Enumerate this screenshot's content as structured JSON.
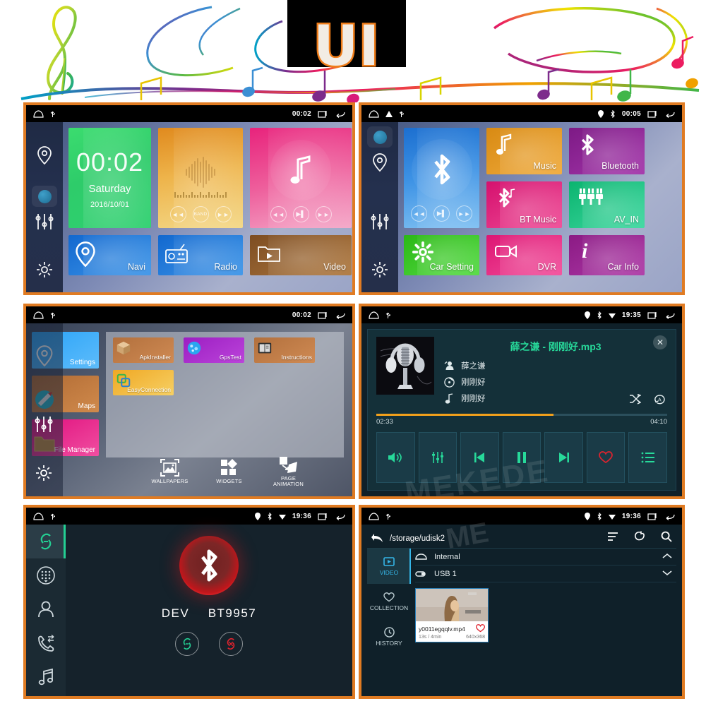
{
  "banner": {
    "logo_text": "UI",
    "logo_stroke_color": "#ef7d1a",
    "logo_fill_color": "#f2ece4"
  },
  "theme": {
    "panel_border": "#e07b22",
    "accent_green": "#27d99a",
    "accent_blue": "#35b6e8",
    "progress_orange": "#f2a01b"
  },
  "panels": {
    "home_main": {
      "name": "home-screen-page-1",
      "statusbar": {
        "time": "00:02",
        "left_icons": [
          "home-icon",
          "usb-icon"
        ],
        "right_icons": [
          "recents-icon",
          "back-icon"
        ]
      },
      "sidebar": [
        {
          "name": "nav-icon",
          "label": "Navigation"
        },
        {
          "name": "page-dot-icon",
          "label": "Page indicator"
        },
        {
          "name": "equalizer-icon",
          "label": "Equalizer"
        },
        {
          "name": "settings-gear-icon",
          "label": "Settings"
        }
      ],
      "clock_widget": {
        "time": "00:02",
        "day": "Saturday",
        "date": "2016/10/01"
      },
      "radio_widget": {
        "prev": "prev-icon",
        "band": "BAND",
        "next": "next-icon"
      },
      "music_widget": {
        "prev": "prev-icon",
        "play": "play-pause-icon",
        "next": "next-icon"
      },
      "shortcuts": [
        {
          "label": "Navi",
          "icon": "location-pin-icon",
          "color": "#1c6fd0"
        },
        {
          "label": "Radio",
          "icon": "radio-icon",
          "color": "#1c6fd0"
        },
        {
          "label": "Video",
          "icon": "video-folder-icon",
          "color": "#8a5a2b"
        }
      ]
    },
    "home_apps": {
      "name": "home-screen-page-2",
      "statusbar": {
        "time": "00:05",
        "left_icons": [
          "home-icon",
          "warning-icon",
          "usb-icon"
        ],
        "right_icons": [
          "gps-icon",
          "bluetooth-icon",
          "recents-icon",
          "back-icon"
        ]
      },
      "bt_widget": {
        "prev": "prev-icon",
        "play": "play-pause-icon",
        "next": "next-icon"
      },
      "tiles": [
        {
          "label": "Music",
          "icon": "music-note-icon",
          "color": "#e09020"
        },
        {
          "label": "Bluetooth",
          "icon": "bluetooth-icon",
          "color": "#8e2795"
        },
        {
          "label": "BT Music",
          "icon": "bt-music-icon",
          "color": "#e02077"
        },
        {
          "label": "AV_IN",
          "icon": "av-plug-icon",
          "color": "#13c27a"
        },
        {
          "label": "Car Setting",
          "icon": "gear-icon",
          "color": "#3bc425"
        },
        {
          "label": "DVR",
          "icon": "camcorder-icon",
          "color": "#e8247c"
        },
        {
          "label": "Car Info",
          "icon": "info-icon",
          "color": "#9b2090"
        }
      ]
    },
    "app_drawer": {
      "name": "app-drawer-screen",
      "statusbar": {
        "time": "00:02",
        "left_icons": [
          "home-icon",
          "usb-icon"
        ],
        "right_icons": [
          "recents-icon",
          "back-icon"
        ]
      },
      "recent_tiles": [
        {
          "label": "Settings",
          "icon": "location-pin-icon"
        },
        {
          "label": "Maps",
          "icon": "maps-icon"
        },
        {
          "label": "File Manager",
          "icon": "folder-icon"
        }
      ],
      "apps": [
        {
          "label": "ApkInstaller",
          "icon": "package-box-icon",
          "style": "orange"
        },
        {
          "label": "GpsTest",
          "icon": "globe-icon",
          "style": "purple"
        },
        {
          "label": "Instructions",
          "icon": "manual-book-icon",
          "style": "orange"
        },
        {
          "label": "EasyConnection",
          "icon": "screen-mirror-icon",
          "style": "yellow"
        }
      ],
      "dock": [
        {
          "label": "WALLPAPERS",
          "icon": "wallpaper-icon"
        },
        {
          "label": "WIDGETS",
          "icon": "widgets-icon"
        },
        {
          "label": "PAGE ANIMATION",
          "icon": "page-animation-icon"
        }
      ]
    },
    "music_player": {
      "name": "music-player-screen",
      "statusbar": {
        "time": "19:35",
        "left_icons": [
          "home-icon",
          "usb-icon"
        ],
        "right_icons": [
          "gps-icon",
          "bluetooth-icon",
          "wifi-icon",
          "recents-icon",
          "back-icon"
        ]
      },
      "title": "薛之谦 - 刚刚好.mp3",
      "artist": "薛之谦",
      "album": "刚刚好",
      "song": "刚刚好",
      "elapsed": "02:33",
      "duration": "04:10",
      "progress_percent": 61,
      "shuffle_icon": "shuffle-icon",
      "repeat_icon": "repeat-all-icon",
      "close_icon": "close-icon",
      "buttons": [
        {
          "name": "volume-button",
          "icon": "volume-icon"
        },
        {
          "name": "equalizer-button",
          "icon": "equalizer-icon"
        },
        {
          "name": "previous-button",
          "icon": "previous-icon"
        },
        {
          "name": "pause-button",
          "icon": "pause-icon"
        },
        {
          "name": "next-button",
          "icon": "next-icon"
        },
        {
          "name": "favorite-button",
          "icon": "heart-icon"
        },
        {
          "name": "playlist-button",
          "icon": "list-icon"
        }
      ],
      "watermark": "MEKEDE"
    },
    "bluetooth": {
      "name": "bluetooth-screen",
      "statusbar": {
        "time": "19:36",
        "left_icons": [
          "home-icon",
          "usb-icon"
        ],
        "right_icons": [
          "gps-icon",
          "bluetooth-icon",
          "wifi-icon",
          "recents-icon",
          "back-icon"
        ]
      },
      "sidebar": [
        {
          "name": "sidebar-item-pair",
          "icon": "link-icon",
          "active": true
        },
        {
          "name": "sidebar-item-dialpad",
          "icon": "dialpad-icon",
          "active": false
        },
        {
          "name": "sidebar-item-contacts",
          "icon": "contact-icon",
          "active": false
        },
        {
          "name": "sidebar-item-calllog",
          "icon": "call-log-icon",
          "active": false
        },
        {
          "name": "sidebar-item-btmusic",
          "icon": "music-note-icon",
          "active": false
        }
      ],
      "device_prefix": "DEV",
      "device_name": "BT9957",
      "connect_icon": "link-connect-icon",
      "disconnect_icon": "link-disconnect-icon"
    },
    "file_manager": {
      "name": "file-manager-screen",
      "statusbar": {
        "time": "19:36",
        "left_icons": [
          "home-icon",
          "usb-icon"
        ],
        "right_icons": [
          "gps-icon",
          "bluetooth-icon",
          "wifi-icon",
          "recents-icon",
          "back-icon"
        ]
      },
      "path": "/storage/udisk2",
      "tools": [
        {
          "name": "sort-button",
          "icon": "sort-icon"
        },
        {
          "name": "refresh-button",
          "icon": "refresh-icon"
        },
        {
          "name": "search-button",
          "icon": "search-icon"
        }
      ],
      "categories": [
        {
          "label": "VIDEO",
          "icon": "video-icon",
          "active": true
        },
        {
          "label": "COLLECTION",
          "icon": "heart-icon",
          "active": false
        },
        {
          "label": "HISTORY",
          "icon": "clock-icon",
          "active": false
        }
      ],
      "storages": [
        {
          "label": "Internal",
          "icon": "internal-storage-icon",
          "chevron": "chevron-up-icon"
        },
        {
          "label": "USB 1",
          "icon": "usb-storage-icon",
          "chevron": "chevron-down-icon"
        }
      ],
      "files": [
        {
          "name": "y0011egqqlv.mp4",
          "duration": "13s / 4min",
          "resolution": "640x368",
          "favorite_icon": "heart-icon"
        }
      ],
      "watermark": "ME"
    }
  }
}
